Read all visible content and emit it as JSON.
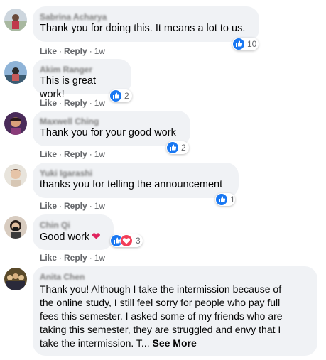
{
  "comments": [
    {
      "name": "Sabrina Acharya",
      "text": "Thank you for doing this. It means a lot to us.",
      "reactions": "10",
      "like": "Like",
      "reply": "Reply",
      "time": "1w"
    },
    {
      "name": "Akim Ranger",
      "text": "This is great work!",
      "reactions": "2",
      "like": "Like",
      "reply": "Reply",
      "time": "1w"
    },
    {
      "name": "Maxwell Ching",
      "text": "Thank you for your good work",
      "reactions": "2",
      "like": "Like",
      "reply": "Reply",
      "time": "1w"
    },
    {
      "name": "Yuki Igarashi",
      "text": "thanks you for telling the announcement",
      "reactions": "1",
      "like": "Like",
      "reply": "Reply",
      "time": "1w"
    },
    {
      "name": "Chin Qi",
      "text": "Good work",
      "reactions": "3",
      "like": "Like",
      "reply": "Reply",
      "time": "1w"
    },
    {
      "name": "Anita Chen",
      "text_lines": [
        "Thank you! Although I take the intermission because of",
        "the online study, I still feel sorry for people who pay full",
        "fees this semester. I asked some of my friends who are",
        "taking this semester, they are struggled and envy that I",
        "take the intermission. T... "
      ],
      "see_more": "See More"
    }
  ],
  "separator": "·",
  "colors": {
    "bubble": "#f0f2f5",
    "like_blue": "#1877f2",
    "love_red": "#f33e58",
    "meta_gray": "#65676b"
  },
  "icons": {
    "like": "thumbs-up-icon",
    "love": "heart-icon"
  }
}
